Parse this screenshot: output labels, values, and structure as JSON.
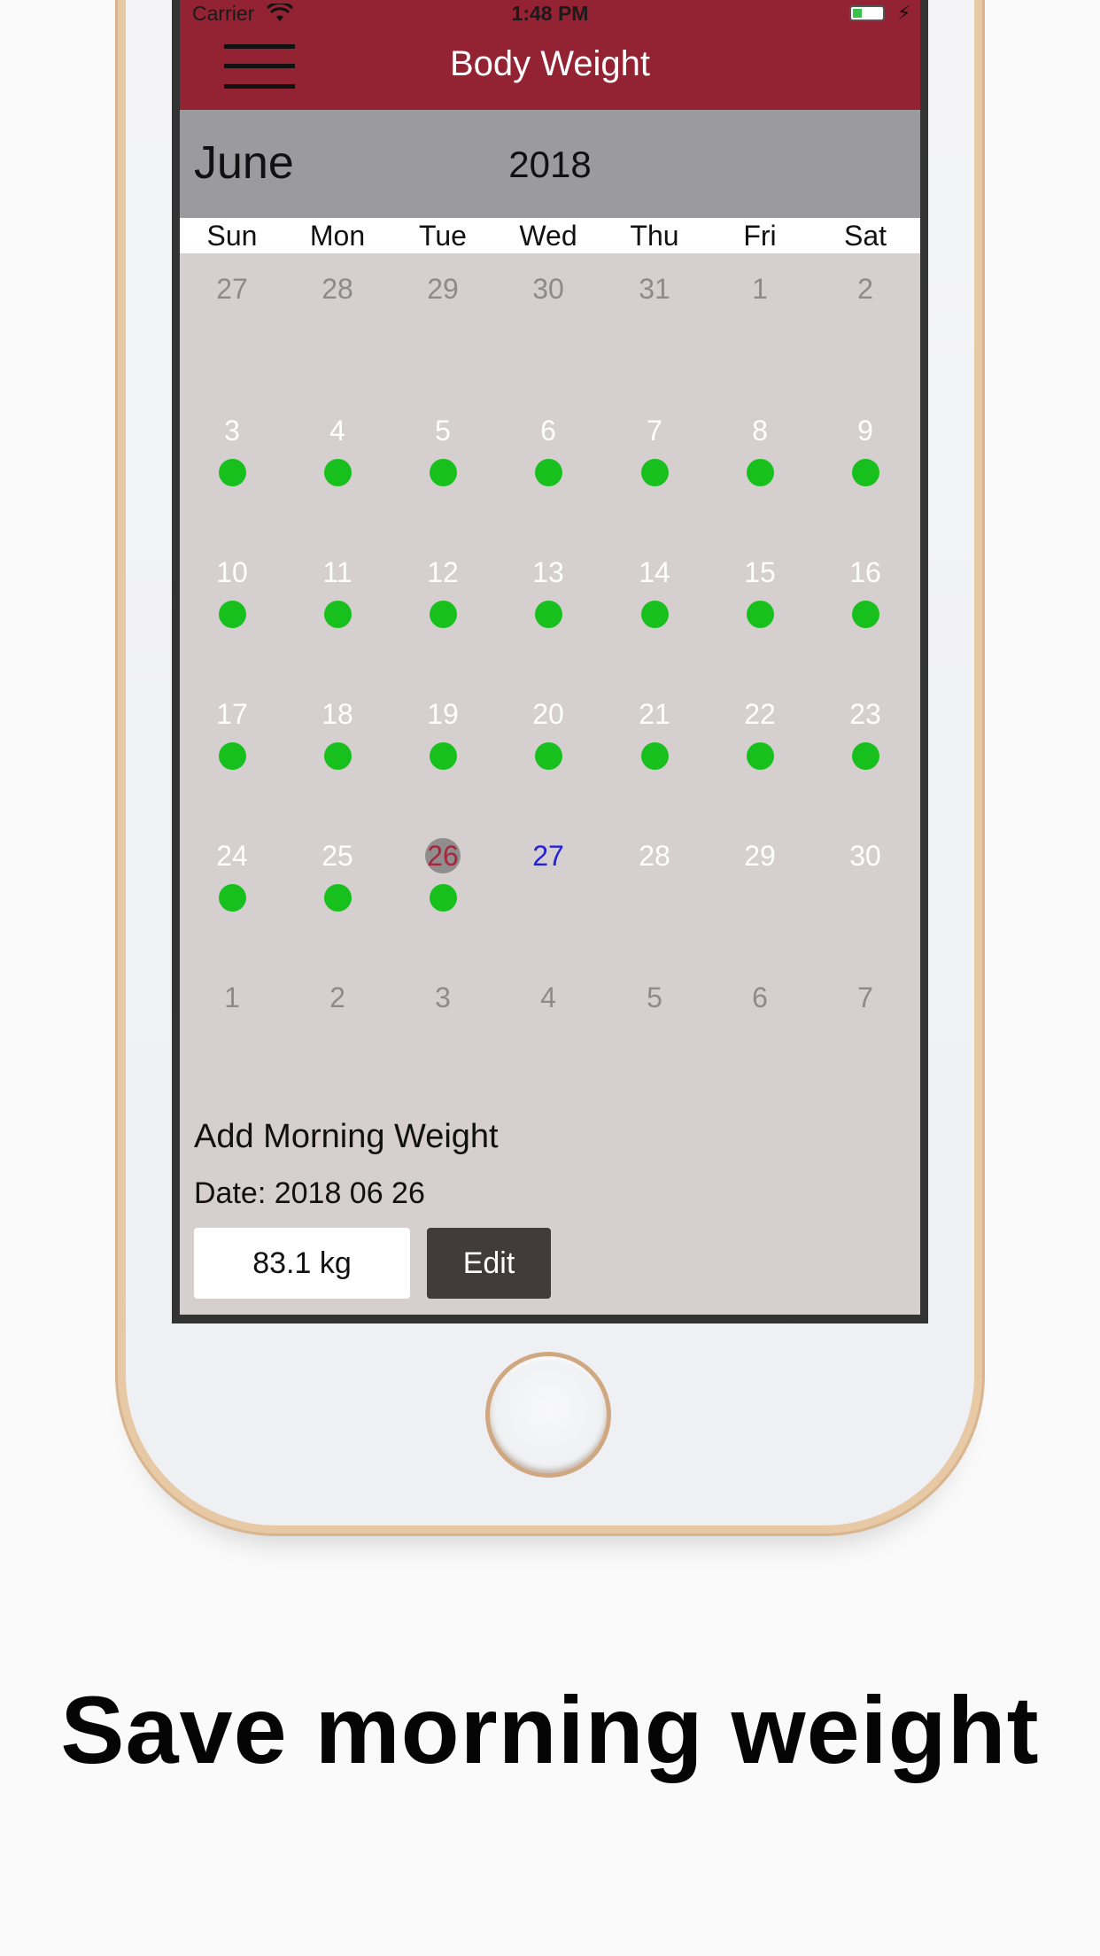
{
  "status_bar": {
    "carrier": "Carrier",
    "time": "1:48 PM"
  },
  "nav": {
    "title": "Body Weight"
  },
  "calendar": {
    "month": "June",
    "year": "2018",
    "weekdays": [
      "Sun",
      "Mon",
      "Tue",
      "Wed",
      "Thu",
      "Fri",
      "Sat"
    ],
    "weeks": [
      [
        {
          "d": "27",
          "other": true
        },
        {
          "d": "28",
          "other": true
        },
        {
          "d": "29",
          "other": true
        },
        {
          "d": "30",
          "other": true
        },
        {
          "d": "31",
          "other": true
        },
        {
          "d": "1",
          "other": true
        },
        {
          "d": "2",
          "other": true
        }
      ],
      [
        {
          "d": "3",
          "dot": true
        },
        {
          "d": "4",
          "dot": true
        },
        {
          "d": "5",
          "dot": true
        },
        {
          "d": "6",
          "dot": true
        },
        {
          "d": "7",
          "dot": true
        },
        {
          "d": "8",
          "dot": true
        },
        {
          "d": "9",
          "dot": true
        }
      ],
      [
        {
          "d": "10",
          "dot": true
        },
        {
          "d": "11",
          "dot": true
        },
        {
          "d": "12",
          "dot": true
        },
        {
          "d": "13",
          "dot": true
        },
        {
          "d": "14",
          "dot": true
        },
        {
          "d": "15",
          "dot": true
        },
        {
          "d": "16",
          "dot": true
        }
      ],
      [
        {
          "d": "17",
          "dot": true
        },
        {
          "d": "18",
          "dot": true
        },
        {
          "d": "19",
          "dot": true
        },
        {
          "d": "20",
          "dot": true
        },
        {
          "d": "21",
          "dot": true
        },
        {
          "d": "22",
          "dot": true
        },
        {
          "d": "23",
          "dot": true
        }
      ],
      [
        {
          "d": "24",
          "dot": true
        },
        {
          "d": "25",
          "dot": true
        },
        {
          "d": "26",
          "dot": true,
          "selected": true
        },
        {
          "d": "27",
          "today": true
        },
        {
          "d": "28"
        },
        {
          "d": "29"
        },
        {
          "d": "30"
        }
      ],
      [
        {
          "d": "1",
          "other": true
        },
        {
          "d": "2",
          "other": true
        },
        {
          "d": "3",
          "other": true
        },
        {
          "d": "4",
          "other": true
        },
        {
          "d": "5",
          "other": true
        },
        {
          "d": "6",
          "other": true
        },
        {
          "d": "7",
          "other": true
        }
      ]
    ]
  },
  "entry": {
    "title": "Add Morning Weight",
    "date_label": "Date: 2018 06 26",
    "weight_value": "83.1 kg",
    "edit_label": "Edit"
  },
  "caption": "Save morning weight",
  "colors": {
    "header": "#932232",
    "month_bar": "#9b9a9c",
    "calendar_bg": "#d6cfcf",
    "dot": "#18c01e",
    "today": "#2222dd",
    "edit_button": "#423b3b"
  }
}
